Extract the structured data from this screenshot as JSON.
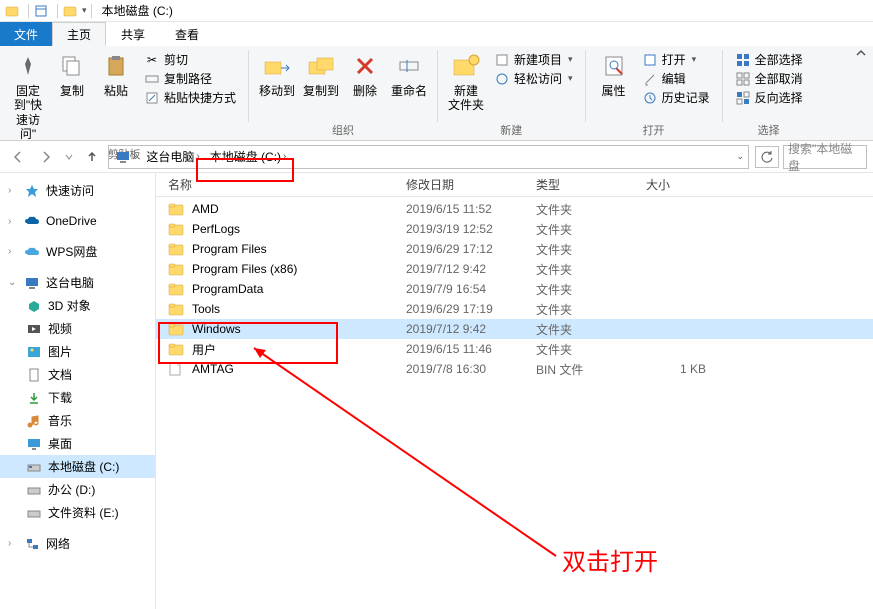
{
  "title": "本地磁盘 (C:)",
  "tabs": {
    "file": "文件",
    "home": "主页",
    "share": "共享",
    "view": "查看"
  },
  "ribbon": {
    "pin": "固定到\"快\n速访问\"",
    "copy": "复制",
    "paste": "粘贴",
    "cut": "剪切",
    "copypath": "复制路径",
    "pasteshort": "粘贴快捷方式",
    "clipboard": "剪贴板",
    "moveto": "移动到",
    "copyto": "复制到",
    "delete": "删除",
    "rename": "重命名",
    "organize": "组织",
    "newfolder": "新建\n文件夹",
    "newitem": "新建项目",
    "easyaccess": "轻松访问",
    "new": "新建",
    "properties": "属性",
    "open": "打开",
    "edit": "编辑",
    "history": "历史记录",
    "openg": "打开",
    "selectall": "全部选择",
    "selectnone": "全部取消",
    "invert": "反向选择",
    "select": "选择"
  },
  "breadcrumb": {
    "pc": "这台电脑",
    "drive": "本地磁盘 (C:)"
  },
  "search": {
    "placeholder": "搜索\"本地磁盘"
  },
  "nav": {
    "quick": "快速访问",
    "onedrive": "OneDrive",
    "wps": "WPS网盘",
    "thispc": "这台电脑",
    "obj3d": "3D 对象",
    "videos": "视频",
    "pictures": "图片",
    "documents": "文档",
    "downloads": "下载",
    "music": "音乐",
    "desktop": "桌面",
    "cdrive": "本地磁盘 (C:)",
    "ddrive": "办公 (D:)",
    "edrive": "文件资料 (E:)",
    "network": "网络"
  },
  "columns": {
    "name": "名称",
    "date": "修改日期",
    "type": "类型",
    "size": "大小"
  },
  "files": [
    {
      "name": "AMD",
      "date": "2019/6/15 11:52",
      "type": "文件夹",
      "size": "",
      "kind": "folder",
      "sel": false
    },
    {
      "name": "PerfLogs",
      "date": "2019/3/19 12:52",
      "type": "文件夹",
      "size": "",
      "kind": "folder",
      "sel": false
    },
    {
      "name": "Program Files",
      "date": "2019/6/29 17:12",
      "type": "文件夹",
      "size": "",
      "kind": "folder",
      "sel": false
    },
    {
      "name": "Program Files (x86)",
      "date": "2019/7/12 9:42",
      "type": "文件夹",
      "size": "",
      "kind": "folder",
      "sel": false
    },
    {
      "name": "ProgramData",
      "date": "2019/7/9 16:54",
      "type": "文件夹",
      "size": "",
      "kind": "folder",
      "sel": false
    },
    {
      "name": "Tools",
      "date": "2019/6/29 17:19",
      "type": "文件夹",
      "size": "",
      "kind": "folder",
      "sel": false
    },
    {
      "name": "Windows",
      "date": "2019/7/12 9:42",
      "type": "文件夹",
      "size": "",
      "kind": "folder",
      "sel": true
    },
    {
      "name": "用户",
      "date": "2019/6/15 11:46",
      "type": "文件夹",
      "size": "",
      "kind": "folder",
      "sel": false
    },
    {
      "name": "AMTAG",
      "date": "2019/7/8 16:30",
      "type": "BIN 文件",
      "size": "1 KB",
      "kind": "file",
      "sel": false
    }
  ],
  "annotation": "双击打开"
}
